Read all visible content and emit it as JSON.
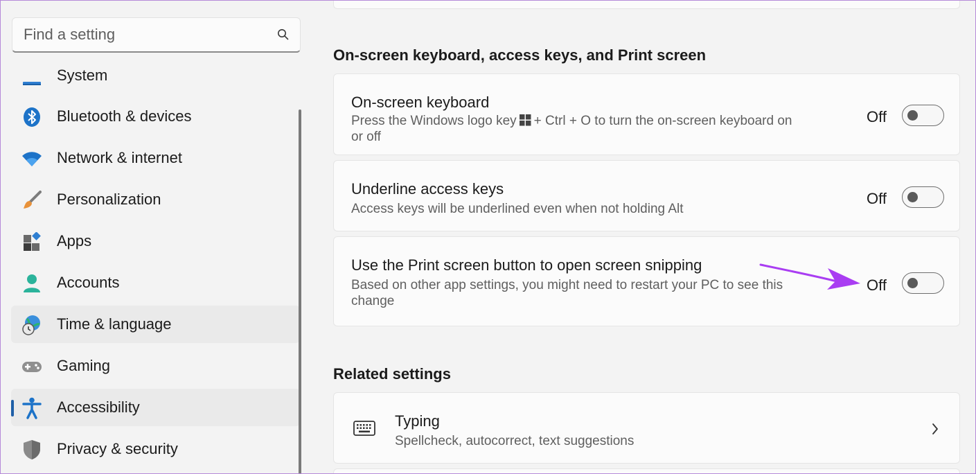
{
  "search": {
    "placeholder": "Find a setting",
    "icon": "search-icon"
  },
  "sidebar": {
    "items": [
      {
        "label": "System",
        "icon": "system-icon"
      },
      {
        "label": "Bluetooth & devices",
        "icon": "bluetooth-icon"
      },
      {
        "label": "Network & internet",
        "icon": "wifi-icon"
      },
      {
        "label": "Personalization",
        "icon": "paintbrush-icon"
      },
      {
        "label": "Apps",
        "icon": "apps-icon"
      },
      {
        "label": "Accounts",
        "icon": "user-icon"
      },
      {
        "label": "Time & language",
        "icon": "globe-clock-icon"
      },
      {
        "label": "Gaming",
        "icon": "gamepad-icon"
      },
      {
        "label": "Accessibility",
        "icon": "accessibility-icon"
      },
      {
        "label": "Privacy & security",
        "icon": "shield-icon"
      }
    ],
    "selected": "Accessibility"
  },
  "main": {
    "section": {
      "title": "On-screen keyboard, access keys, and Print screen",
      "rows": [
        {
          "title": "On-screen keyboard",
          "desc_before_logo": "Press the Windows logo key",
          "desc_after_logo": "+ Ctrl + O to turn the on-screen keyboard on",
          "desc_line2": "or off",
          "state": "Off"
        },
        {
          "title": "Underline access keys",
          "desc": "Access keys will be underlined even when not holding Alt",
          "state": "Off"
        },
        {
          "title": "Use the Print screen button to open screen snipping",
          "desc": "Based on other app settings, you might need to restart your PC to see this",
          "desc_line2": "change",
          "state": "Off"
        }
      ]
    },
    "related": {
      "title": "Related settings",
      "typing": {
        "title": "Typing",
        "desc": "Spellcheck, autocorrect, text suggestions",
        "icon": "keyboard-icon"
      }
    }
  },
  "colors": {
    "accent": "#1f5fa8",
    "annotation_arrow": "#a93df2",
    "window_border": "#b58ad9"
  }
}
